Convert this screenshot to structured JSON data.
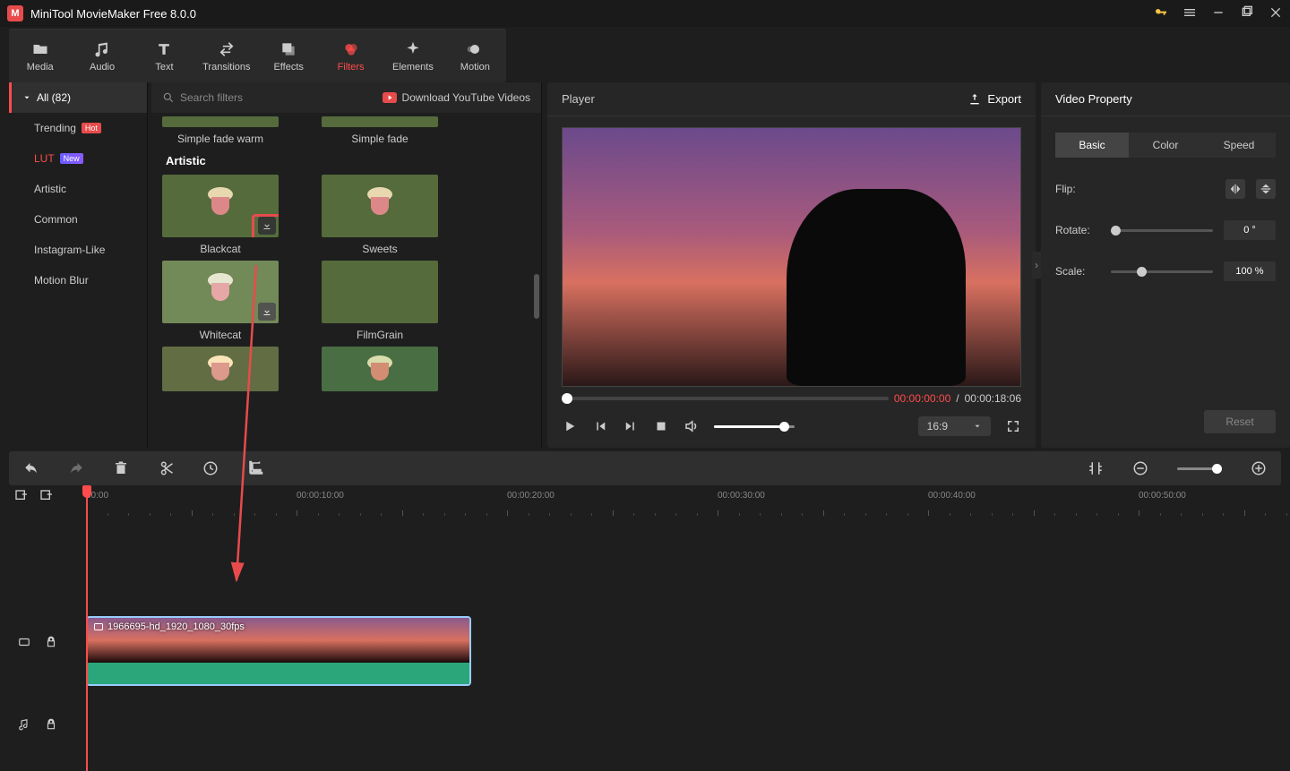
{
  "app": {
    "title": "MiniTool MovieMaker Free 8.0.0"
  },
  "toptabs": {
    "media": "Media",
    "audio": "Audio",
    "text": "Text",
    "transitions": "Transitions",
    "effects": "Effects",
    "filters": "Filters",
    "elements": "Elements",
    "motion": "Motion"
  },
  "sidebar": {
    "all": "All (82)",
    "items": [
      {
        "label": "Trending",
        "badge": "Hot"
      },
      {
        "label": "LUT",
        "badge": "New"
      },
      {
        "label": "Artistic"
      },
      {
        "label": "Common"
      },
      {
        "label": "Instagram-Like"
      },
      {
        "label": "Motion Blur"
      }
    ]
  },
  "filterpanel": {
    "search_placeholder": "Search filters",
    "download_yt": "Download YouTube Videos",
    "row0": {
      "a": "Simple fade warm",
      "b": "Simple fade"
    },
    "cat1": "Artistic",
    "row1": {
      "a": "Blackcat",
      "b": "Sweets"
    },
    "row2": {
      "a": "Whitecat",
      "b": "FilmGrain"
    }
  },
  "player": {
    "title": "Player",
    "export": "Export",
    "cur": "00:00:00:00",
    "sep": " / ",
    "dur": "00:00:18:06",
    "aspect": "16:9"
  },
  "prop": {
    "title": "Video Property",
    "tabs": {
      "basic": "Basic",
      "color": "Color",
      "speed": "Speed"
    },
    "flip": "Flip:",
    "rotate": "Rotate:",
    "rotate_val": "0 °",
    "scale": "Scale:",
    "scale_val": "100 %",
    "reset": "Reset"
  },
  "timeline": {
    "marks": [
      "00:00",
      "00:00:10:00",
      "00:00:20:00",
      "00:00:30:00",
      "00:00:40:00",
      "00:00:50:00"
    ],
    "clip_label": "1966695-hd_1920_1080_30fps"
  }
}
